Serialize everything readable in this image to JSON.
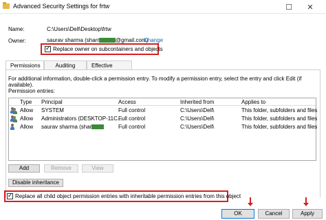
{
  "window": {
    "title": "Advanced Security Settings for frtw",
    "maximize_glyph": "☐",
    "close_glyph": "✕"
  },
  "name_row": {
    "label": "Name:",
    "value": "C:\\Users\\Dell\\Desktop\\frtw"
  },
  "owner_row": {
    "label": "Owner:",
    "value_prefix": "saurav sharma (sharr",
    "value_suffix": "@gmail.com)",
    "change_link": "Change"
  },
  "replace_owner": {
    "label": "Replace owner on subcontainers and objects",
    "checked": true
  },
  "tabs": [
    {
      "label": "Permissions",
      "active": true
    },
    {
      "label": "Auditing",
      "active": false
    },
    {
      "label": "Effective Access",
      "active": false
    }
  ],
  "info_text": "For additional information, double-click a permission entry. To modify a permission entry, select the entry and click Edit (if available).",
  "entries_label": "Permission entries:",
  "table": {
    "headers": [
      "Type",
      "Principal",
      "Access",
      "Inherited from",
      "Applies to"
    ],
    "rows": [
      {
        "type": "Allow",
        "principal": "SYSTEM",
        "access": "Full control",
        "inherited": "C:\\Users\\Dell\\",
        "applies": "This folder, subfolders and files"
      },
      {
        "type": "Allow",
        "principal": "Administrators (DESKTOP-11C...",
        "access": "Full control",
        "inherited": "C:\\Users\\Dell\\",
        "applies": "This folder, subfolders and files"
      },
      {
        "type": "Allow",
        "principal": "saurav sharma (shar",
        "access": "Full control",
        "inherited": "C:\\Users\\Dell\\",
        "applies": "This folder, subfolders and files"
      }
    ]
  },
  "buttons": {
    "add": "Add",
    "remove": "Remove",
    "view": "View",
    "disable_inheritance": "Disable inheritance"
  },
  "replace_child": {
    "label": "Replace all child object permission entries with inheritable permission entries from this object",
    "checked": true
  },
  "footer": {
    "ok": "OK",
    "cancel": "Cancel",
    "apply": "Apply"
  },
  "colors": {
    "highlight": "#d32020",
    "link": "#1a5fb4",
    "redacted": "#3c8b37"
  }
}
